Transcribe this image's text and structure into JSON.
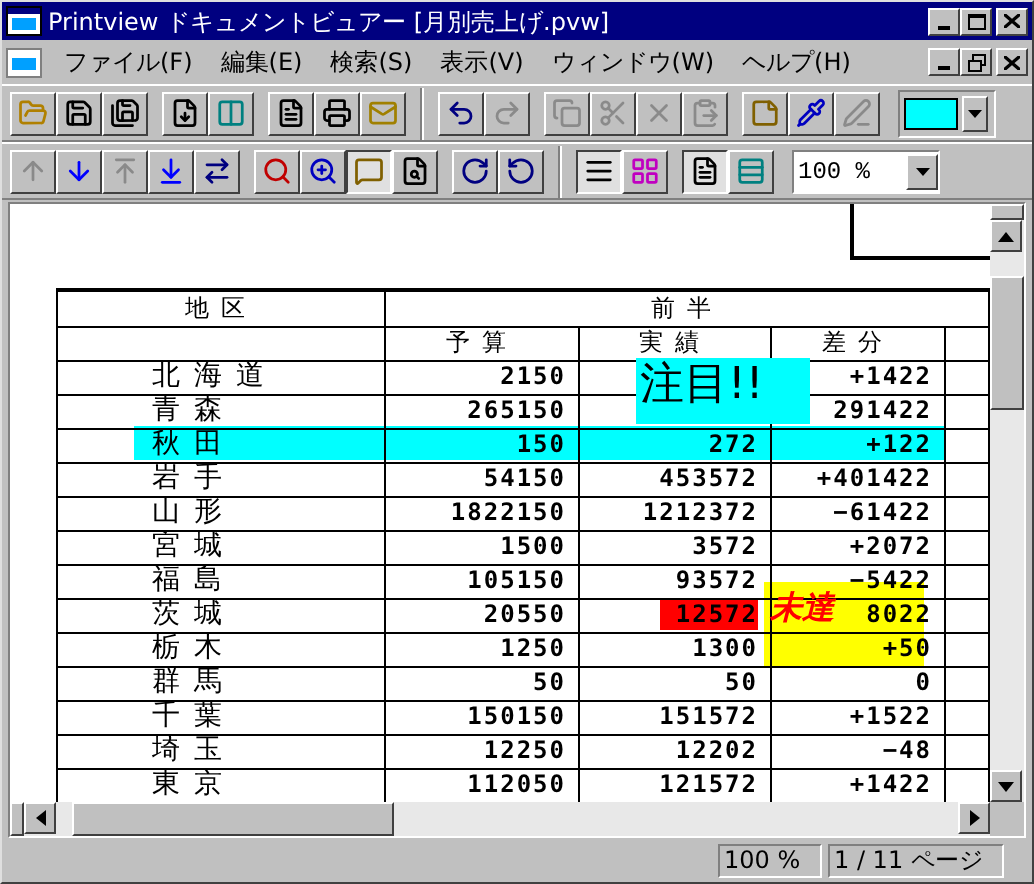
{
  "window": {
    "title": "Printview ドキュメントビュアー [月別売上げ.pvw]"
  },
  "menu": [
    "ファイル(F)",
    "編集(E)",
    "検索(S)",
    "表示(V)",
    "ウィンドウ(W)",
    "ヘルプ(H)"
  ],
  "toolbars": [
    {
      "items": [
        {
          "kind": "group",
          "buttons": [
            {
              "disabled": false,
              "selected": false
            },
            {
              "disabled": false,
              "selected": false
            },
            {
              "disabled": false,
              "selected": false
            }
          ]
        },
        {
          "kind": "group",
          "buttons": [
            {
              "disabled": false,
              "selected": false
            },
            {
              "disabled": false,
              "selected": false
            }
          ]
        },
        {
          "kind": "group",
          "buttons": [
            {
              "disabled": false,
              "selected": false
            },
            {
              "disabled": false,
              "selected": false
            },
            {
              "disabled": false,
              "selected": false
            }
          ]
        },
        {
          "kind": "separator"
        },
        {
          "kind": "group",
          "buttons": [
            {
              "disabled": false,
              "selected": false
            },
            {
              "disabled": true,
              "selected": false
            }
          ]
        },
        {
          "kind": "group",
          "buttons": [
            {
              "disabled": true,
              "selected": false
            },
            {
              "disabled": true,
              "selected": false
            },
            {
              "disabled": true,
              "selected": false
            },
            {
              "disabled": true,
              "selected": false
            }
          ]
        },
        {
          "kind": "group",
          "buttons": [
            {
              "disabled": false,
              "selected": false
            },
            {
              "disabled": false,
              "selected": false
            },
            {
              "disabled": true,
              "selected": false
            }
          ]
        },
        {
          "kind": "color",
          "color": "#00ffff"
        }
      ]
    },
    {
      "items": [
        {
          "kind": "group",
          "buttons": [
            {
              "disabled": true,
              "selected": false
            },
            {
              "disabled": false,
              "selected": false
            },
            {
              "disabled": true,
              "selected": false
            },
            {
              "disabled": false,
              "selected": false
            },
            {
              "disabled": false,
              "selected": false
            }
          ]
        },
        {
          "kind": "group",
          "buttons": [
            {
              "disabled": false,
              "selected": false
            },
            {
              "disabled": false,
              "selected": false
            },
            {
              "disabled": false,
              "selected": true
            },
            {
              "disabled": false,
              "selected": false
            }
          ]
        },
        {
          "kind": "group",
          "buttons": [
            {
              "disabled": false,
              "selected": false
            },
            {
              "disabled": false,
              "selected": false
            }
          ]
        },
        {
          "kind": "separator"
        },
        {
          "kind": "group",
          "buttons": [
            {
              "disabled": false,
              "selected": true
            },
            {
              "disabled": false,
              "selected": false
            }
          ]
        },
        {
          "kind": "group",
          "buttons": [
            {
              "disabled": false,
              "selected": true
            },
            {
              "disabled": false,
              "selected": false
            }
          ]
        },
        {
          "kind": "select",
          "value": "100 %"
        }
      ]
    }
  ],
  "table": {
    "group_header": "前半",
    "area_header": "地区",
    "columns": [
      "予算",
      "実績",
      "差分"
    ],
    "rows": [
      {
        "area": "北海道",
        "budget": "2150",
        "diff": "+1422",
        "highlight": false
      },
      {
        "area": "青森",
        "budget": "265150",
        "diff": "291422",
        "highlight": false
      },
      {
        "area": "秋田",
        "budget": "150",
        "actual": "272",
        "diff": "+122",
        "highlight": true,
        "actual_flag": false
      },
      {
        "area": "岩手",
        "budget": "54150",
        "actual": "453572",
        "diff": "+401422",
        "highlight": false,
        "actual_flag": false
      },
      {
        "area": "山形",
        "budget": "1822150",
        "actual": "1212372",
        "diff": "−61422",
        "highlight": false,
        "actual_flag": false
      },
      {
        "area": "宮城",
        "budget": "1500",
        "actual": "3572",
        "diff": "+2072",
        "highlight": false,
        "actual_flag": false
      },
      {
        "area": "福島",
        "budget": "105150",
        "actual": "93572",
        "diff": "−5422",
        "highlight": false,
        "actual_flag": false
      },
      {
        "area": "茨城",
        "budget": "20550",
        "actual": "12572",
        "diff": "8022",
        "highlight": false,
        "actual_flag": true
      },
      {
        "area": "栃木",
        "budget": "1250",
        "actual": "1300",
        "diff": "+50",
        "highlight": false,
        "actual_flag": false
      },
      {
        "area": "群馬",
        "budget": "50",
        "actual": "50",
        "diff": "0",
        "highlight": false,
        "actual_flag": false
      },
      {
        "area": "千葉",
        "budget": "150150",
        "actual": "151572",
        "diff": "+1522",
        "highlight": false,
        "actual_flag": false
      },
      {
        "area": "埼玉",
        "budget": "12250",
        "actual": "12202",
        "diff": "−48",
        "highlight": false,
        "actual_flag": false
      },
      {
        "area": "東京",
        "budget": "112050",
        "actual": "121572",
        "diff": "+1422",
        "highlight": false,
        "actual_flag": false
      }
    ]
  },
  "callouts": [
    {
      "kind": "note",
      "text": "注目!!"
    },
    {
      "kind": "stamp",
      "text": "未達"
    }
  ],
  "status_bar": [
    "100 %",
    "1 / 11 ページ"
  ]
}
